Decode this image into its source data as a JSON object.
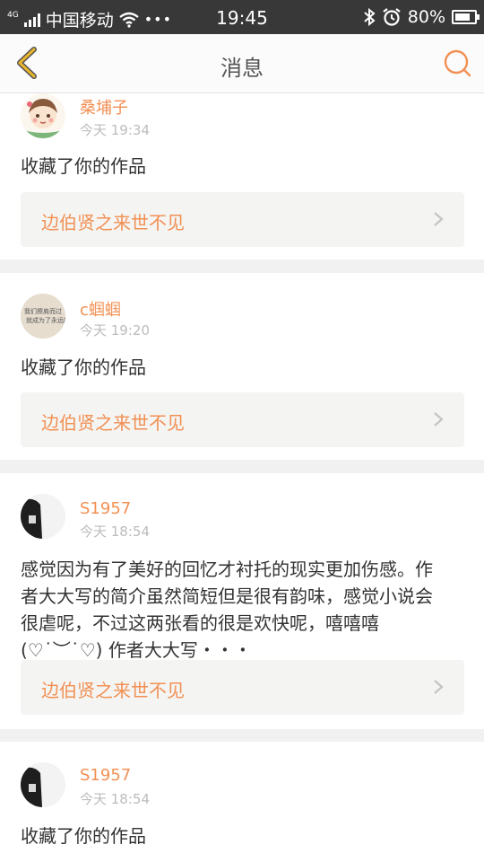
{
  "status": {
    "carrier": "中国移动",
    "net": "4G",
    "time": "19:45",
    "battery": "80%",
    "battery_level": 0.8
  },
  "nav": {
    "title": "消息"
  },
  "colors": {
    "accent": "#f29054",
    "back_icon": "#e8b52c"
  },
  "messages": [
    {
      "user": "桑埔子",
      "time": "今天 19:34",
      "text": "收藏了你的作品",
      "work": "边伯贤之来世不见",
      "avatar": "cartoon-girl-avatar"
    },
    {
      "user": "c蝈蝈",
      "time": "今天 19:20",
      "text": "收藏了你的作品",
      "work": "边伯贤之来世不见",
      "avatar": "handwriting-avatar",
      "avatar_text": [
        "我们擦肩而过",
        "就成为了永远的"
      ]
    },
    {
      "user": "S1957",
      "time": "今天 18:54",
      "text_lines": [
        "感觉因为有了美好的回忆才衬托的现实更加伤感。作",
        "者大大写的简介虽然简短但是很有韵味，感觉小说会",
        "很虐呢，不过这两张看的很是欢快呢，嘻嘻嘻",
        "(♡˙︶˙♡) 作者大大写・・・"
      ],
      "work": "边伯贤之来世不见",
      "avatar": "dark-photo-avatar"
    },
    {
      "user": "S1957",
      "time": "今天 18:54",
      "text": "收藏了你的作品",
      "avatar": "dark-photo-avatar"
    }
  ]
}
